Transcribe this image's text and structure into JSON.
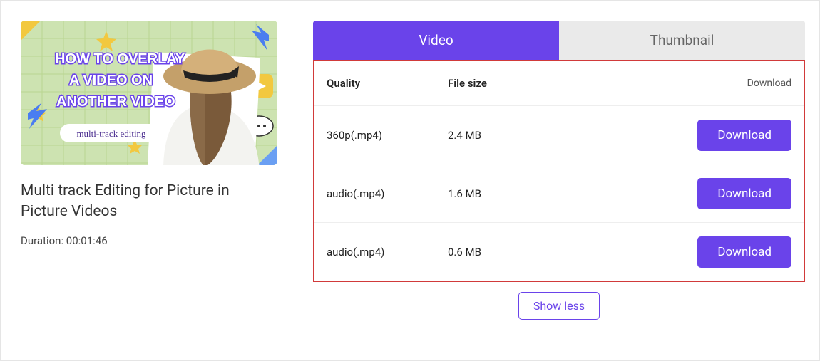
{
  "video": {
    "title": "Multi track Editing for Picture in Picture Videos",
    "duration_label": "Duration: 00:01:46",
    "thumbnail_overlay": {
      "line1": "HOW TO OVERLAY",
      "line2": "A VIDEO ON",
      "line3": "ANOTHER VIDEO",
      "chip": "multi-track editing"
    }
  },
  "tabs": {
    "video": "Video",
    "thumbnail": "Thumbnail"
  },
  "table": {
    "headers": {
      "quality": "Quality",
      "filesize": "File size",
      "download": "Download"
    },
    "rows": [
      {
        "quality": "360p(.mp4)",
        "filesize": "2.4 MB",
        "download_label": "Download"
      },
      {
        "quality": "audio(.mp4)",
        "filesize": "1.6 MB",
        "download_label": "Download"
      },
      {
        "quality": "audio(.mp4)",
        "filesize": "0.6 MB",
        "download_label": "Download"
      }
    ]
  },
  "show_less": "Show less",
  "colors": {
    "accent": "#6a43ea",
    "highlight_border": "#d13a3a"
  }
}
